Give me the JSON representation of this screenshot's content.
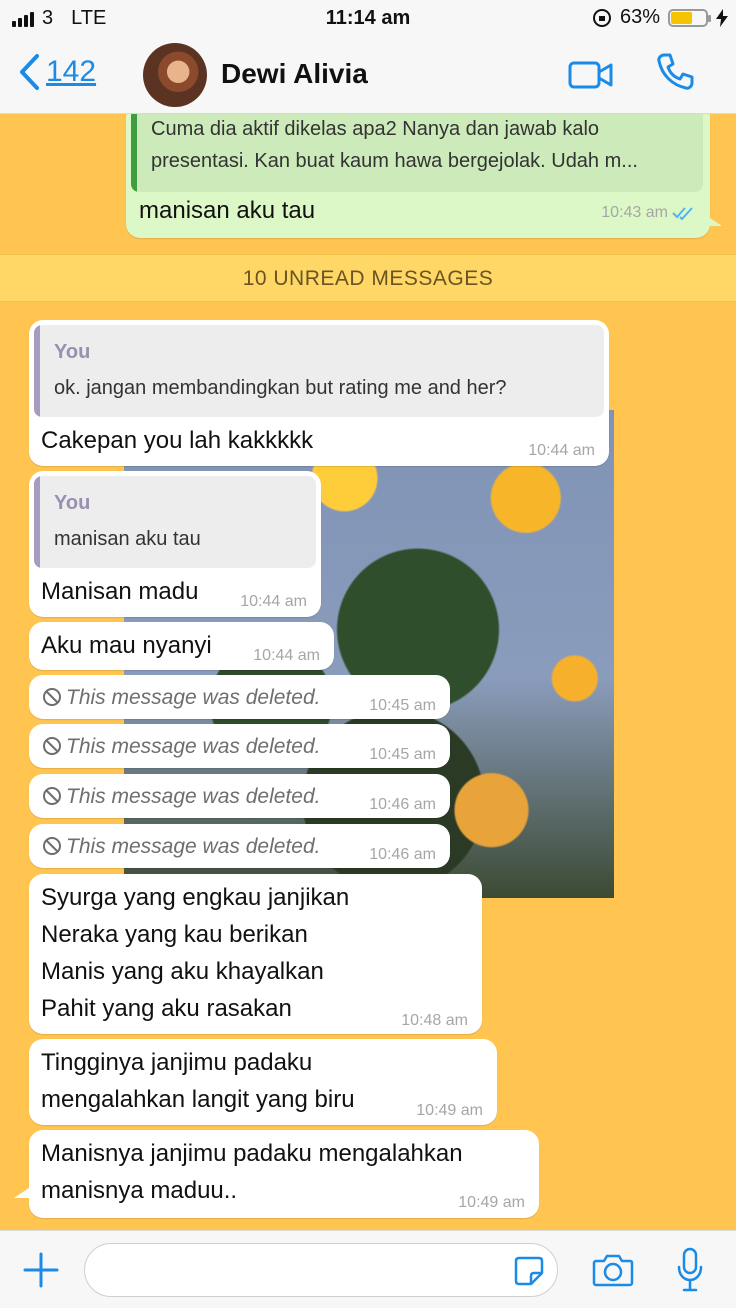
{
  "status_bar": {
    "carrier": "3",
    "network": "LTE",
    "time": "11:14 am",
    "battery": "63%",
    "battery_level": 0.63
  },
  "header": {
    "back_count": "142",
    "contact_name": "Dewi Alivia"
  },
  "chat": {
    "sent_reply": {
      "quote_text_line1": "Cuma dia aktif dikelas apa2 Nanya dan jawab kalo",
      "quote_text_line2": "presentasi. Kan buat kaum hawa bergejolak. Udah m...",
      "text": "manisan aku tau",
      "time": "10:43 am",
      "status": "read"
    },
    "unread_banner": "10 UNREAD MESSAGES",
    "messages": [
      {
        "quote_name": "You",
        "quote_text": "ok. jangan membandingkan but rating me and her?",
        "text": "Cakepan you lah kakkkkk",
        "time": "10:44 am"
      },
      {
        "quote_name": "You",
        "quote_text": "manisan aku tau",
        "text": "Manisan madu",
        "time": "10:44 am"
      },
      {
        "text": "Aku mau nyanyi",
        "time": "10:44 am"
      },
      {
        "text": "This message was deleted.",
        "time": "10:45 am"
      },
      {
        "text": "This message was deleted.",
        "time": "10:45 am"
      },
      {
        "text": "This message was deleted.",
        "time": "10:46 am"
      },
      {
        "text": "This message was deleted.",
        "time": "10:46 am"
      },
      {
        "line1": "Syurga yang engkau janjikan",
        "line2": "Neraka yang kau berikan",
        "line3": "Manis yang aku khayalkan",
        "line4": "Pahit yang aku rasakan",
        "time": "10:48 am"
      },
      {
        "line1": "Tingginya janjimu padaku",
        "line2": "mengalahkan langit yang biru",
        "time": "10:49 am"
      },
      {
        "line1": "Manisnya janjimu padaku mengalahkan",
        "line2": "manisnya maduu..",
        "time": "10:49 am"
      }
    ]
  },
  "composer": {
    "value": ""
  },
  "colors": {
    "accent": "#1A8BE6",
    "wallpaper": "#FFC550",
    "sent_bubble": "#DCF8C6",
    "read_ticks": "#4FB3F6"
  },
  "icons": [
    "back-chevron-icon",
    "video-call-icon",
    "phone-icon",
    "plus-icon",
    "sticker-icon",
    "camera-icon",
    "microphone-icon",
    "deleted-icon",
    "read-ticks-icon"
  ]
}
